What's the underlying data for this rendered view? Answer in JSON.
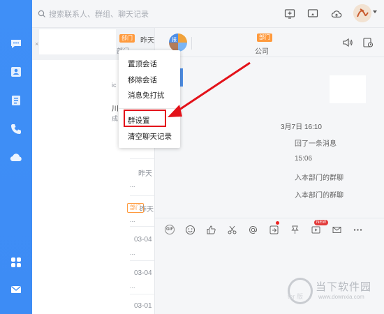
{
  "search": {
    "placeholder": "搜索联系人、群组、聊天记录"
  },
  "conversation_list": {
    "top_item": {
      "tag": "部门",
      "time": "昨天",
      "sub": "部门"
    },
    "partial_texts": [
      "ic",
      "川当",
      "成"
    ],
    "rows": [
      {
        "time": "昨天",
        "snippet": "..."
      },
      {
        "tag": "部门",
        "time": "昨天",
        "snippet": "..."
      },
      {
        "time": "03-04",
        "snippet": "..."
      },
      {
        "time": "03-04",
        "snippet": "..."
      },
      {
        "time": "03-01",
        "snippet": "..."
      }
    ]
  },
  "chat": {
    "header": {
      "tag": "部门",
      "name": "公司",
      "avatar_text": "报"
    },
    "messages": [
      "3月7日 16:10",
      "回了一条消息",
      "15:06",
      "入本部门的群聊",
      "入本部门的群聊"
    ],
    "badge_new": "NEW",
    "tool_gif": "GIF"
  },
  "context_menu": {
    "items": [
      "置顶会话",
      "移除会话",
      "消息免打扰",
      "群设置",
      "清空聊天记录"
    ],
    "highlighted": "群设置"
  },
  "watermark": {
    "title": "当下软件园",
    "url": "www.downxia.com",
    "faint": "ter 版"
  },
  "colors": {
    "rail": "#3f8ff7",
    "highlight": "#e3121a",
    "dept_tag": "#ff9a3d"
  },
  "icons": {
    "rail": [
      "chat-icon",
      "contacts-icon",
      "apps-icon",
      "phone-icon",
      "cloud-icon",
      "grid-icon",
      "mail-icon"
    ],
    "topbar": [
      "add-icon",
      "screen-share-icon",
      "cloud-upload-icon"
    ]
  }
}
